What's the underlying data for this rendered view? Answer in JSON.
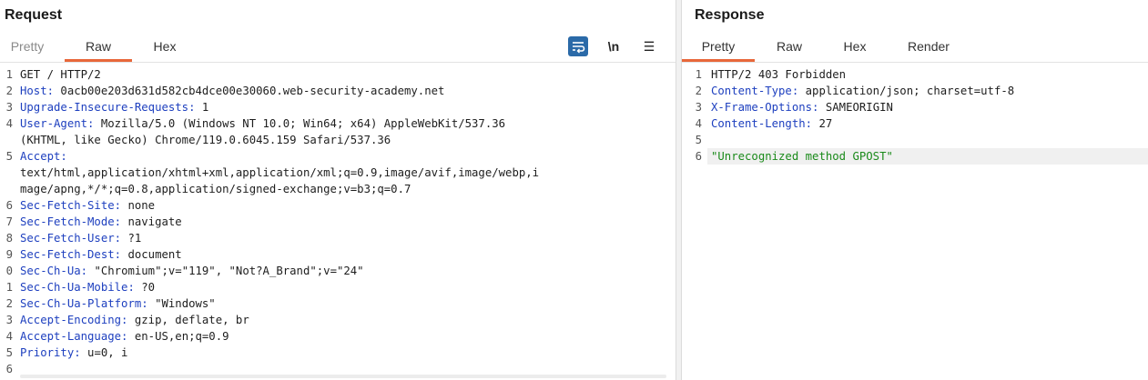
{
  "request": {
    "title": "Request",
    "tabs": [
      "Pretty",
      "Raw",
      "Hex"
    ],
    "active_tab": "Raw",
    "toolbar": {
      "newline_label": "\\n",
      "menu_label": "☰"
    },
    "lines": [
      {
        "n": "1",
        "k": "",
        "v": "GET / HTTP/2"
      },
      {
        "n": "2",
        "k": "Host:",
        "v": " 0acb00e203d631d582cb4dce00e30060.web-security-academy.net"
      },
      {
        "n": "3",
        "k": "Upgrade-Insecure-Requests:",
        "v": " 1"
      },
      {
        "n": "4",
        "k": "User-Agent:",
        "v": " Mozilla/5.0 (Windows NT 10.0; Win64; x64) AppleWebKit/537.36"
      },
      {
        "n": "",
        "k": "",
        "v": "(KHTML, like Gecko) Chrome/119.0.6045.159 Safari/537.36"
      },
      {
        "n": "5",
        "k": "Accept:",
        "v": ""
      },
      {
        "n": "",
        "k": "",
        "v": "text/html,application/xhtml+xml,application/xml;q=0.9,image/avif,image/webp,i"
      },
      {
        "n": "",
        "k": "",
        "v": "mage/apng,*/*;q=0.8,application/signed-exchange;v=b3;q=0.7"
      },
      {
        "n": "6",
        "k": "Sec-Fetch-Site:",
        "v": " none"
      },
      {
        "n": "7",
        "k": "Sec-Fetch-Mode:",
        "v": " navigate"
      },
      {
        "n": "8",
        "k": "Sec-Fetch-User:",
        "v": " ?1"
      },
      {
        "n": "9",
        "k": "Sec-Fetch-Dest:",
        "v": " document"
      },
      {
        "n": "0",
        "k": "Sec-Ch-Ua:",
        "v": " \"Chromium\";v=\"119\", \"Not?A_Brand\";v=\"24\""
      },
      {
        "n": "1",
        "k": "Sec-Ch-Ua-Mobile:",
        "v": " ?0"
      },
      {
        "n": "2",
        "k": "Sec-Ch-Ua-Platform:",
        "v": " \"Windows\""
      },
      {
        "n": "3",
        "k": "Accept-Encoding:",
        "v": " gzip, deflate, br"
      },
      {
        "n": "4",
        "k": "Accept-Language:",
        "v": " en-US,en;q=0.9"
      },
      {
        "n": "5",
        "k": "Priority:",
        "v": " u=0, i"
      },
      {
        "n": "6",
        "k": "",
        "v": ""
      }
    ]
  },
  "response": {
    "title": "Response",
    "tabs": [
      "Pretty",
      "Raw",
      "Hex",
      "Render"
    ],
    "active_tab": "Pretty",
    "lines": [
      {
        "n": "1",
        "k": "",
        "v": "HTTP/2 403 Forbidden",
        "s": ""
      },
      {
        "n": "2",
        "k": "Content-Type:",
        "v": " application/json; charset=utf-8",
        "s": ""
      },
      {
        "n": "3",
        "k": "X-Frame-Options:",
        "v": " SAMEORIGIN",
        "s": ""
      },
      {
        "n": "4",
        "k": "Content-Length:",
        "v": " 27",
        "s": ""
      },
      {
        "n": "5",
        "k": "",
        "v": "",
        "s": ""
      },
      {
        "n": "6",
        "k": "",
        "v": "",
        "s": "\"Unrecognized method GPOST\""
      }
    ]
  }
}
